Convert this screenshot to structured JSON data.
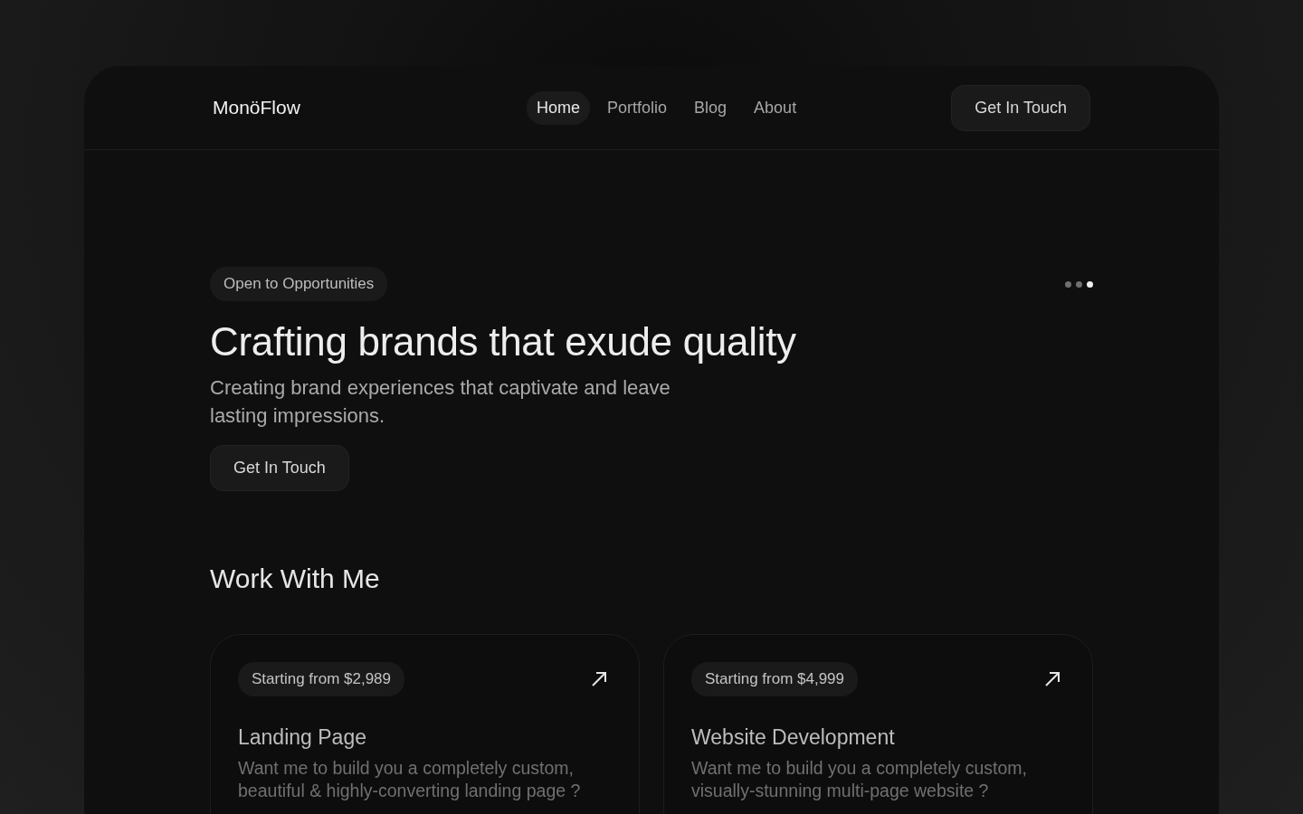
{
  "header": {
    "logo": "MonöFlow",
    "nav": [
      {
        "label": "Home",
        "selected": true
      },
      {
        "label": "Portfolio",
        "selected": false
      },
      {
        "label": "Blog",
        "selected": false
      },
      {
        "label": "About",
        "selected": false
      }
    ],
    "cta": "Get In Touch"
  },
  "hero": {
    "badge": "Open to Opportunities",
    "dots": [
      {
        "selected": false
      },
      {
        "selected": false
      },
      {
        "selected": true
      }
    ],
    "title": "Crafting brands that exude quality",
    "subtitle": "Creating brand experiences that captivate and leave lasting impressions.",
    "button": "Get In Touch"
  },
  "work": {
    "title": "Work With Me",
    "cards": [
      {
        "price": "Starting from $2,989",
        "title": "Landing Page",
        "text": "Want me to build you a completely custom, beautiful & highly-converting landing page ?"
      },
      {
        "price": "Starting from $4,999",
        "title": "Website Development",
        "text": "Want me to build you a completely custom, visually-stunning multi-page website ?"
      }
    ]
  }
}
